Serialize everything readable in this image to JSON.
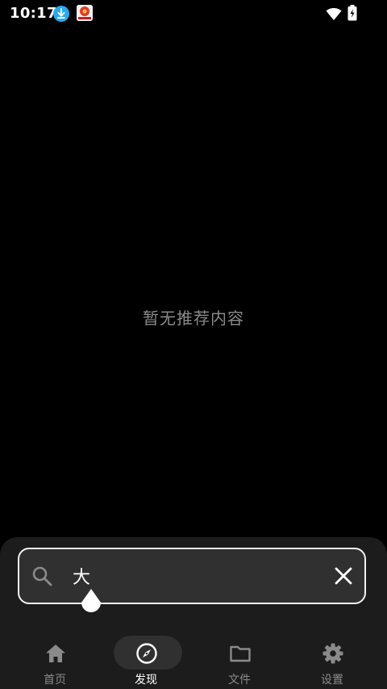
{
  "status_bar": {
    "time": "10:17",
    "icons": [
      "download-notification-icon",
      "app-notification-icon",
      "wifi-icon",
      "battery-charging-icon"
    ]
  },
  "main": {
    "empty_message": "暂无推荐内容"
  },
  "search": {
    "value": "大",
    "icons": [
      "search-icon",
      "clear-icon"
    ]
  },
  "nav": {
    "items": [
      {
        "label": "首页",
        "icon": "home-icon",
        "active": false
      },
      {
        "label": "发现",
        "icon": "compass-icon",
        "active": true
      },
      {
        "label": "文件",
        "icon": "folder-icon",
        "active": false
      },
      {
        "label": "设置",
        "icon": "gear-icon",
        "active": false
      }
    ]
  },
  "colors": {
    "background": "#000000",
    "panel": "#1c1c1c",
    "search_field": "#303030",
    "accent_border": "#f1f1f1",
    "muted_text": "#8a8a8a",
    "download_badge": "#2aa8f2"
  }
}
